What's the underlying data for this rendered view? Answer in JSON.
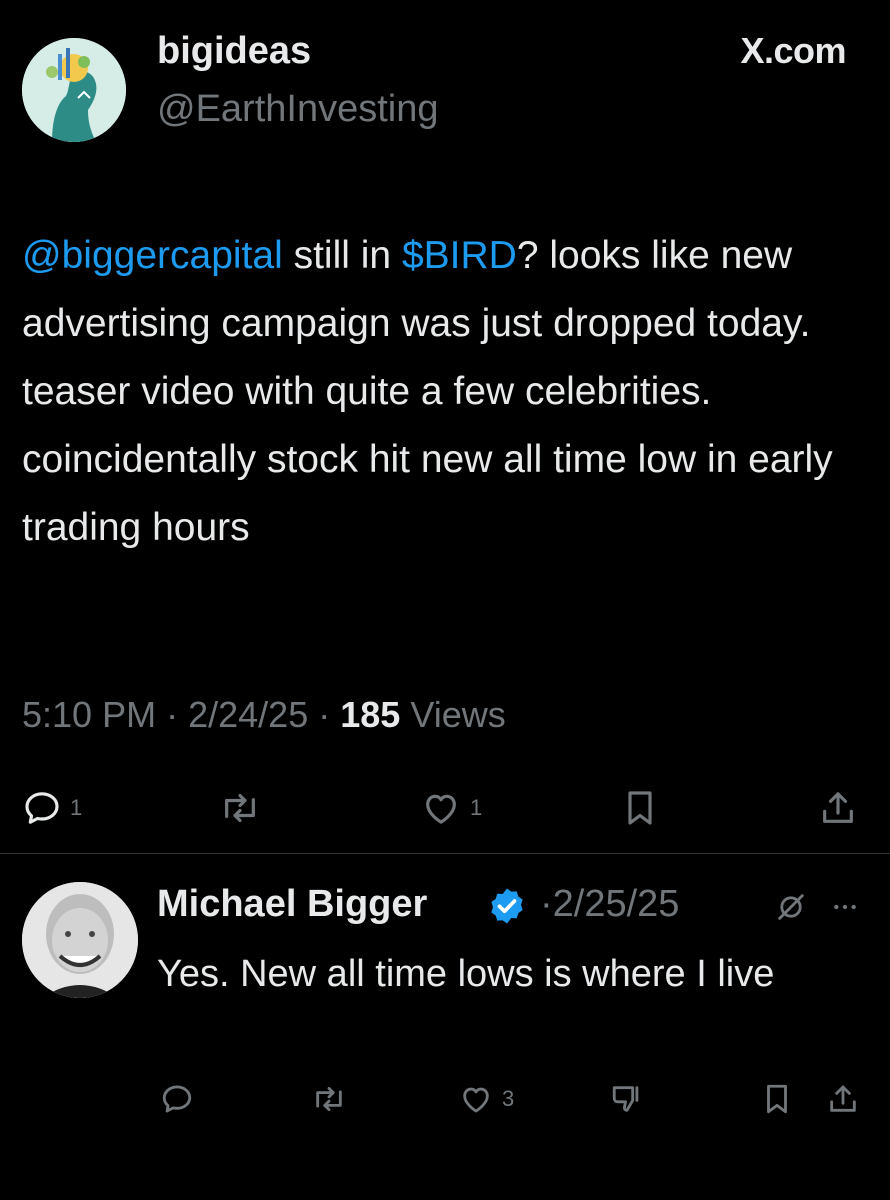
{
  "tweet": {
    "display_name": "bigideas",
    "handle": "@EarthInvesting",
    "site_label": "X.com",
    "mention": "@biggercapital",
    "text_part1": " still in ",
    "cashtag": "$BIRD",
    "text_part2": "? looks like new advertising campaign was just dropped today. teaser video with quite a few celebrities. coincidentally stock hit new all time low in early trading hours",
    "time": "5:10 PM",
    "separator": "·",
    "date": "2/24/25",
    "views_count": "185",
    "views_label": "Views",
    "actions": {
      "reply_count": "1",
      "repost_count": "",
      "like_count": "1"
    }
  },
  "reply": {
    "display_name": "Michael Bigger",
    "separator": "·",
    "date": "2/25/25",
    "text": "Yes. New all time lows is where I live",
    "actions": {
      "reply_count": "",
      "repost_count": "",
      "like_count": "3"
    }
  },
  "colors": {
    "background": "#000000",
    "text": "#e7e9ea",
    "secondary": "#71767b",
    "link": "#1d9bf0",
    "verified": "#1d9bf0"
  }
}
